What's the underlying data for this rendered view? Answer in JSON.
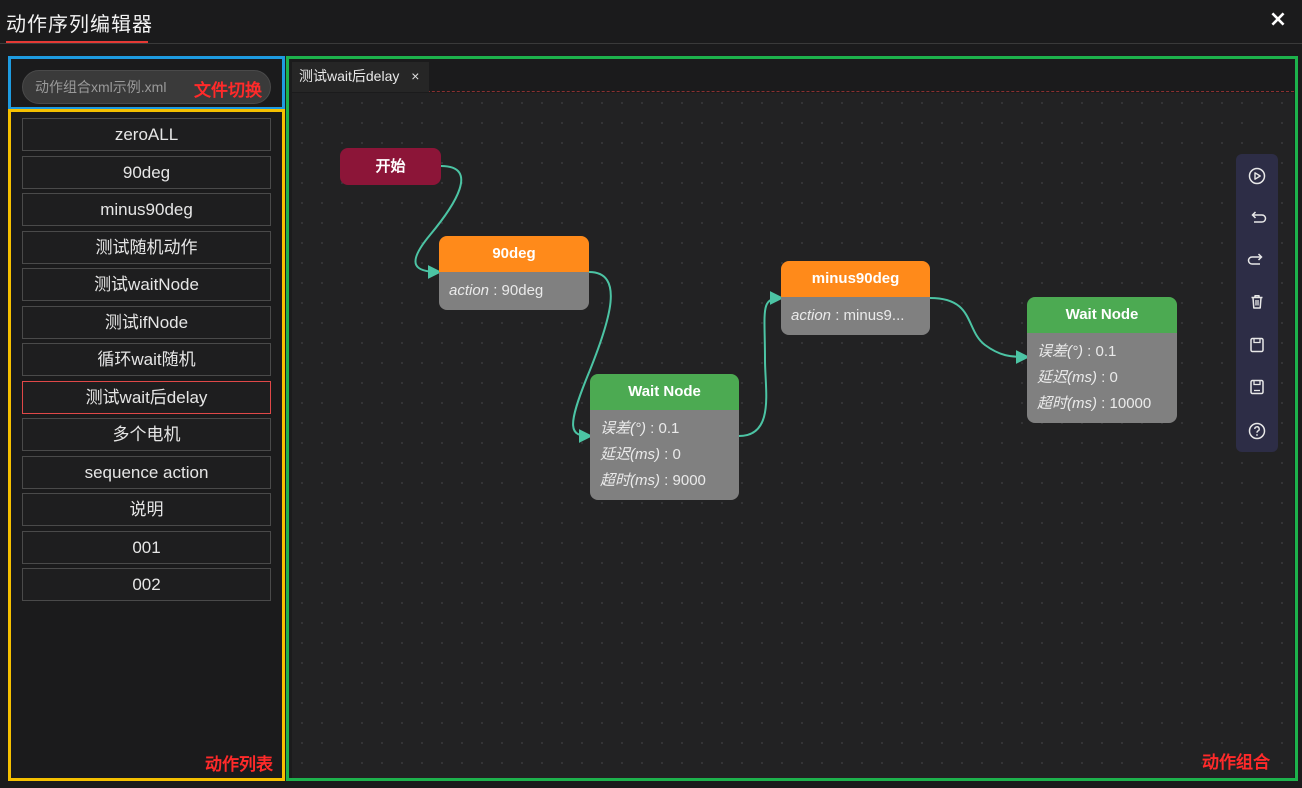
{
  "header": {
    "title": "动作序列编辑器",
    "close_label": "×"
  },
  "file_switch": {
    "value": "动作组合xml示例.xml",
    "region_label": "文件切换"
  },
  "action_list": {
    "region_label": "动作列表",
    "items": [
      {
        "label": "zeroALL"
      },
      {
        "label": "90deg"
      },
      {
        "label": "minus90deg"
      },
      {
        "label": "测试随机动作"
      },
      {
        "label": "测试waitNode"
      },
      {
        "label": "测试ifNode"
      },
      {
        "label": "循环wait随机"
      },
      {
        "label": "测试wait后delay"
      },
      {
        "label": "多个电机"
      },
      {
        "label": "sequence action"
      },
      {
        "label": "说明"
      },
      {
        "label": "001"
      },
      {
        "label": "002"
      }
    ],
    "active_index": 7
  },
  "canvas": {
    "region_label": "动作组合",
    "tab": {
      "label": "测试wait后delay",
      "close_label": "×"
    },
    "start_node": {
      "label": "开始"
    },
    "nodes": [
      {
        "title": "90deg",
        "rows": [
          {
            "k": "action",
            "v": "90deg"
          }
        ]
      },
      {
        "title": "Wait Node",
        "rows": [
          {
            "k": "误差(°)",
            "v": "0.1"
          },
          {
            "k": "延迟(ms)",
            "v": "0"
          },
          {
            "k": "超时(ms)",
            "v": "9000"
          }
        ]
      },
      {
        "title": "minus90deg",
        "rows": [
          {
            "k": "action",
            "v": "minus9..."
          }
        ]
      },
      {
        "title": "Wait Node",
        "rows": [
          {
            "k": "误差(°)",
            "v": "0.1"
          },
          {
            "k": "延迟(ms)",
            "v": "0"
          },
          {
            "k": "超时(ms)",
            "v": "10000"
          }
        ]
      }
    ]
  },
  "toolbar": {
    "buttons": [
      {
        "icon": "play-icon"
      },
      {
        "icon": "undo-icon"
      },
      {
        "icon": "redo-icon"
      },
      {
        "icon": "trash-icon"
      },
      {
        "icon": "save-icon"
      },
      {
        "icon": "save-as-icon"
      },
      {
        "icon": "help-icon"
      }
    ]
  },
  "colors": {
    "accent_red": "#e53935",
    "start_node": "#8c1538",
    "action_node": "#ff8a1a",
    "wait_node": "#4caa52",
    "edge": "#4cc4a4",
    "outline_blue": "#1e9be0",
    "outline_yellow": "#f5c000",
    "outline_green": "#1db24c"
  }
}
